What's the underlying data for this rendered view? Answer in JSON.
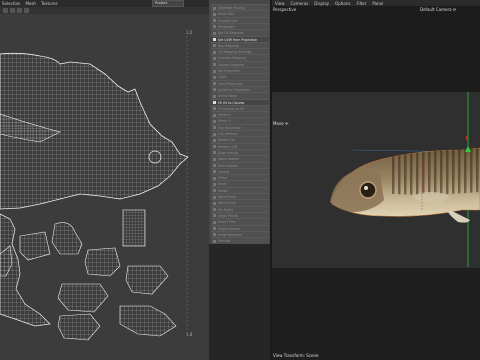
{
  "uv_editor": {
    "menu": [
      "Selection",
      "Mesh",
      "Textures"
    ],
    "object_dropdown": "Project",
    "corner_tl": "1,0",
    "corner_bl": "1,8"
  },
  "tools": {
    "items": [
      {
        "label": "Optimize Pinning"
      },
      {
        "label": "Relax UVs"
      },
      {
        "label": "Unwrap UVs"
      },
      {
        "label": "Straighten"
      },
      {
        "label": "Set UV Selection"
      },
      {
        "label": "Set UVW from Projection",
        "active": true
      },
      {
        "label": "Box Mapping"
      },
      {
        "label": "UV Mapping Settings"
      },
      {
        "label": "Cylinder Mapping"
      },
      {
        "label": "Sphere Mapping"
      },
      {
        "label": "Set Projection"
      },
      {
        "label": "Cubic"
      },
      {
        "label": "Front Projection"
      },
      {
        "label": "Spherical Projection"
      },
      {
        "label": "Shrink Wrap"
      },
      {
        "label": "Fit UV to Canvas",
        "active": true
      },
      {
        "label": "Fit Canvas to UV"
      },
      {
        "label": "Mirror U"
      },
      {
        "label": "Mirror V"
      },
      {
        "label": "Flip Horizontal"
      },
      {
        "label": "Flip Vertical"
      },
      {
        "label": "Rotate CW"
      },
      {
        "label": "Rotate CCW"
      },
      {
        "label": "Align Islands"
      },
      {
        "label": "Stack Islands"
      },
      {
        "label": "Pack Islands"
      },
      {
        "label": "Layout"
      },
      {
        "label": "Offset"
      },
      {
        "label": "Scale"
      },
      {
        "label": "Rotate"
      },
      {
        "label": "Weld Points"
      },
      {
        "label": "Split Points"
      },
      {
        "label": "Pin Points"
      },
      {
        "label": "Unpin Points"
      },
      {
        "label": "Select Pins"
      },
      {
        "label": "Select Islands"
      },
      {
        "label": "Grow Selection"
      },
      {
        "label": "Preview"
      }
    ]
  },
  "viewport": {
    "menu": [
      "View",
      "Cameras",
      "Display",
      "Options",
      "Filter",
      "Panel"
    ],
    "perspective_label": "Perspective",
    "camera_label": "Default Camera ⟳",
    "move_label": "Move ✛",
    "status": "View Transform: Scene"
  },
  "colors": {
    "uv_background": "#3c3c3c",
    "uv_wire": "#d0d0d0",
    "viewport_mid": "#2f2f2f",
    "axis_green": "#2ecc40",
    "axis_blue": "#3a78c8"
  }
}
